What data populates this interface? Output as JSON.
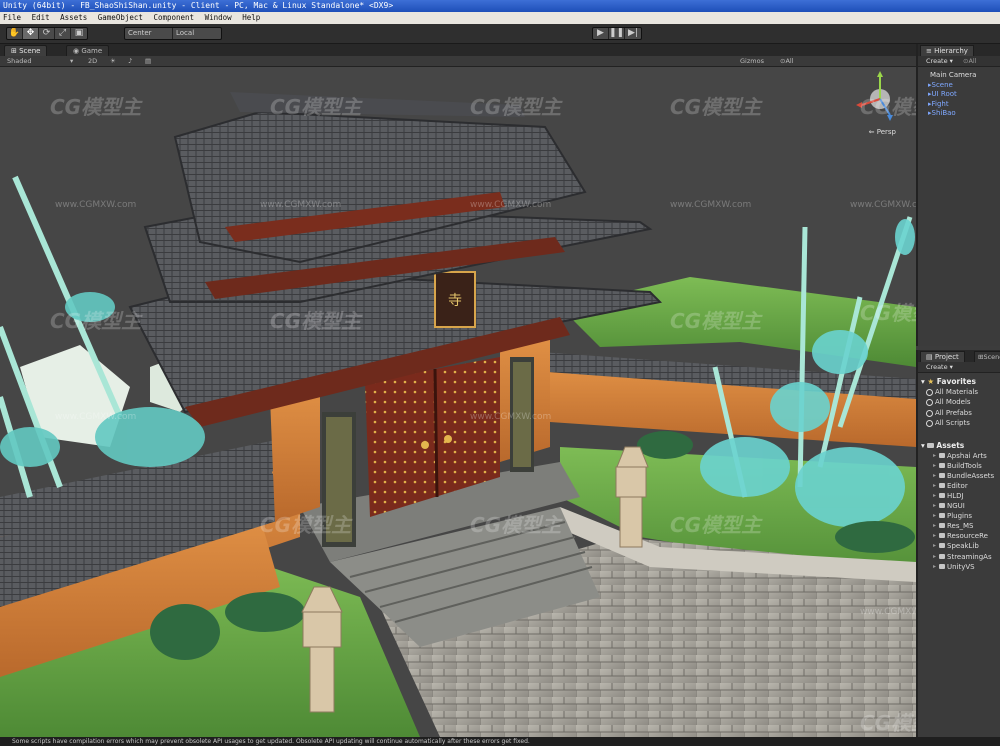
{
  "window": {
    "title": "Unity (64bit) - FB_ShaoShiShan.unity - Client - PC, Mac & Linux Standalone* <DX9>"
  },
  "menu": [
    "File",
    "Edit",
    "Assets",
    "GameObject",
    "Component",
    "Window",
    "Help"
  ],
  "toolbar": {
    "pivot_label": "Center",
    "space_label": "Local",
    "play_icon": "▶",
    "pause_icon": "❚❚",
    "step_icon": "▶|"
  },
  "scene": {
    "tabs": [
      "Scene",
      "Game"
    ],
    "shading": "Shaded",
    "mode_2d": "2D",
    "gizmos_label": "Gizmos",
    "search_placeholder": "⊙All",
    "persp_label": "⇐ Persp"
  },
  "watermarks": {
    "logo": "CG模型主",
    "url": "www.CGMXW.com"
  },
  "hierarchy": {
    "tab": "Hierarchy",
    "create_label": "Create ▾",
    "search_placeholder": "⊙All",
    "items": [
      {
        "label": "Main Camera",
        "style": "normal"
      },
      {
        "label": "Scene",
        "style": "blue"
      },
      {
        "label": "UI Root",
        "style": "blue"
      },
      {
        "label": "Fight",
        "style": "blue"
      },
      {
        "label": "ShiBao",
        "style": "blue"
      }
    ]
  },
  "project": {
    "tab": "Project",
    "tab2": "Scene",
    "create_label": "Create ▾",
    "favorites_title": "Favorites",
    "favorites": [
      "All Materials",
      "All Models",
      "All Prefabs",
      "All Scripts"
    ],
    "assets_title": "Assets",
    "assets": [
      "Apshai Arts",
      "BuildTools",
      "BundleAssets",
      "Editor",
      "HLDJ",
      "NGUI",
      "Plugins",
      "Res_MS",
      "ResourceRe",
      "SpeakLib",
      "StreamingAs",
      "UnityVS"
    ]
  },
  "status": {
    "message": "Some scripts have compilation errors which may prevent obsolete API usages to get updated. Obsolete API updating will continue automatically after these errors get fixed."
  },
  "colors": {
    "editor_bg": "#3c3c3c",
    "title_blue": "#1e4fb8",
    "hierarchy_blue": "#7fa8ff",
    "wall_orange": "#d9843c",
    "grass": "#6ca84a",
    "roof": "#55575a",
    "bamboo": "#8fd8c9"
  }
}
